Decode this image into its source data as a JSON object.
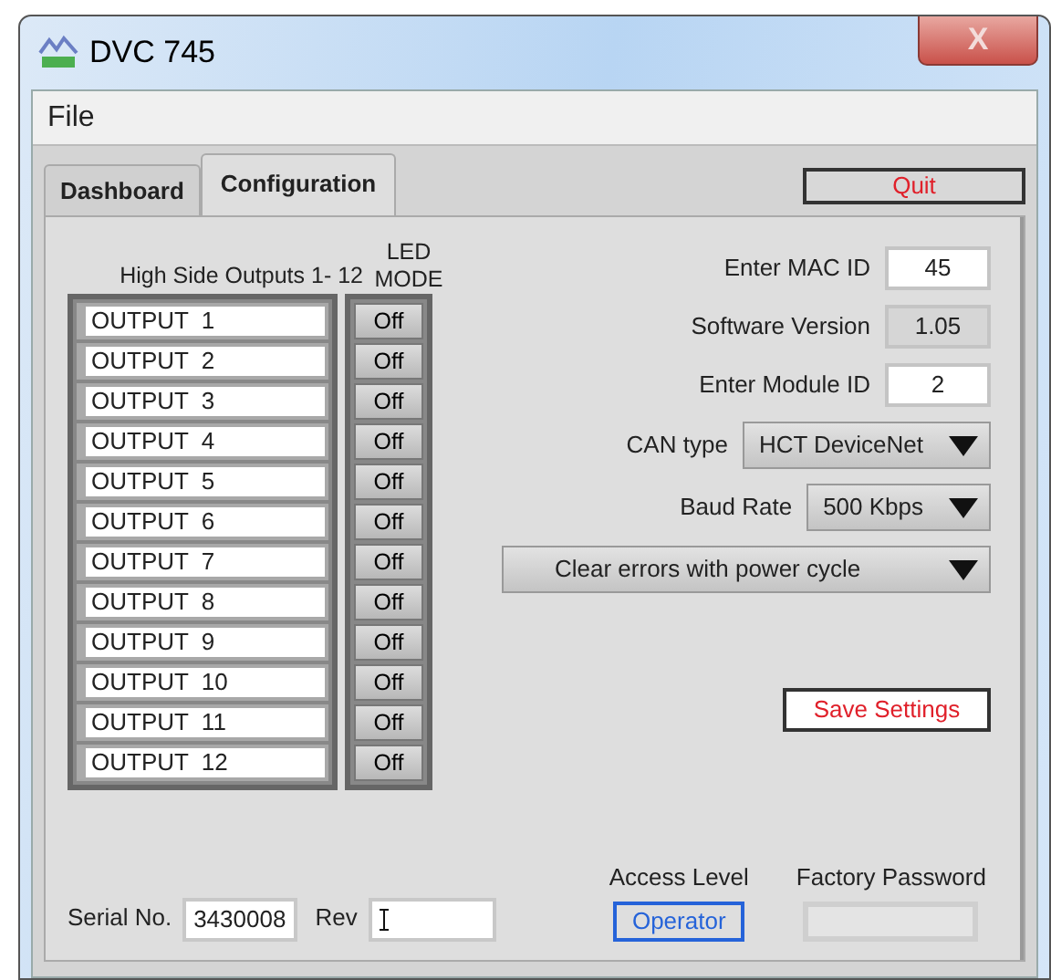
{
  "window": {
    "title": "DVC 745",
    "close": "X"
  },
  "menu": [
    "File"
  ],
  "tabs": [
    {
      "label": "Dashboard",
      "selected": false
    },
    {
      "label": "Configuration",
      "selected": true
    }
  ],
  "quit_button": "Quit",
  "outputs": {
    "heading": "High Side Outputs  1- 12",
    "led_heading": "LED MODE",
    "items": [
      {
        "name": "OUTPUT  1",
        "mode": "Off"
      },
      {
        "name": "OUTPUT  2",
        "mode": "Off"
      },
      {
        "name": "OUTPUT  3",
        "mode": "Off"
      },
      {
        "name": "OUTPUT  4",
        "mode": "Off"
      },
      {
        "name": "OUTPUT  5",
        "mode": "Off"
      },
      {
        "name": "OUTPUT  6",
        "mode": "Off"
      },
      {
        "name": "OUTPUT  7",
        "mode": "Off"
      },
      {
        "name": "OUTPUT  8",
        "mode": "Off"
      },
      {
        "name": "OUTPUT  9",
        "mode": "Off"
      },
      {
        "name": "OUTPUT  10",
        "mode": "Off"
      },
      {
        "name": "OUTPUT  11",
        "mode": "Off"
      },
      {
        "name": "OUTPUT  12",
        "mode": "Off"
      }
    ]
  },
  "settings": [
    {
      "kind": "input",
      "label": "Enter MAC ID",
      "value": "45"
    },
    {
      "kind": "readonly",
      "label": "Software Version",
      "value": "1.05"
    },
    {
      "kind": "input",
      "label": "Enter Module ID",
      "value": "2"
    },
    {
      "kind": "dropdown",
      "label": "CAN type",
      "value": "HCT DeviceNet"
    },
    {
      "kind": "dropdown",
      "label": "Baud Rate",
      "value": "500 Kbps"
    },
    {
      "kind": "wide-dropdown",
      "value": "Clear errors with power cycle"
    }
  ],
  "save_button": "Save Settings",
  "serial": {
    "label": "Serial No.",
    "value": "3430008"
  },
  "rev": {
    "label": "Rev"
  },
  "access_level": {
    "label": "Access Level",
    "value": "Operator"
  },
  "factory_password": {
    "label": "Factory Password"
  }
}
